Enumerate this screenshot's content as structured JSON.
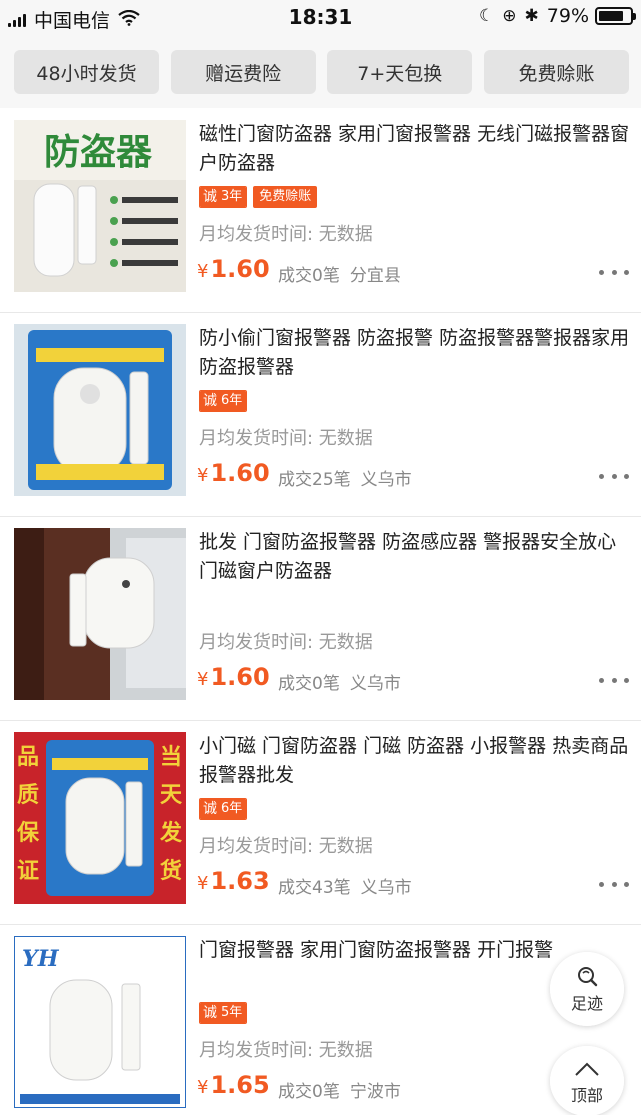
{
  "status_bar": {
    "carrier": "中国电信",
    "time": "18:31",
    "battery": "79%",
    "battery_level": 0.79
  },
  "service_tags": [
    "48小时发货",
    "赠运费险",
    "7+天包换",
    "免费赊账"
  ],
  "products": [
    {
      "title": "磁性门窗防盗器 家用门窗报警器 无线门磁报警器窗户防盗器",
      "cheng": "诚",
      "years": "3年",
      "free_credit": "免费赊账",
      "ship": "月均发货时间: 无数据",
      "yen": "¥",
      "price": "1.60",
      "sold": "成交0笔",
      "location": "分宜县",
      "thumb_text": "防盗器"
    },
    {
      "title": "防小偷门窗报警器 防盗报警 防盗报警器警报器家用防盗报警器",
      "cheng": "诚",
      "years": "6年",
      "free_credit": "",
      "ship": "月均发货时间: 无数据",
      "yen": "¥",
      "price": "1.60",
      "sold": "成交25笔",
      "location": "义乌市",
      "thumb_text": ""
    },
    {
      "title": "批发 门窗防盗报警器 防盗感应器 警报器安全放心门磁窗户防盗器",
      "cheng": "",
      "years": "",
      "free_credit": "",
      "ship": "月均发货时间: 无数据",
      "yen": "¥",
      "price": "1.60",
      "sold": "成交0笔",
      "location": "义乌市",
      "thumb_text": ""
    },
    {
      "title": "小门磁 门窗防盗器 门磁 防盗器 小报警器 热卖商品 报警器批发",
      "cheng": "诚",
      "years": "6年",
      "free_credit": "",
      "ship": "月均发货时间: 无数据",
      "yen": "¥",
      "price": "1.63",
      "sold": "成交43笔",
      "location": "义乌市",
      "thumb_text_left": "品质保证",
      "thumb_text_right": "当天发货"
    },
    {
      "title": "门窗报警器  家用门窗防盗报警器 开门报警",
      "cheng": "诚",
      "years": "5年",
      "free_credit": "",
      "ship": "月均发货时间: 无数据",
      "yen": "¥",
      "price": "1.65",
      "sold": "成交0笔",
      "location": "宁波市",
      "thumb_text": "YH"
    }
  ],
  "floating": {
    "footprint_label": "足迹",
    "top_label": "顶部"
  },
  "colors": {
    "accent": "#f15a22",
    "muted": "#999999"
  }
}
